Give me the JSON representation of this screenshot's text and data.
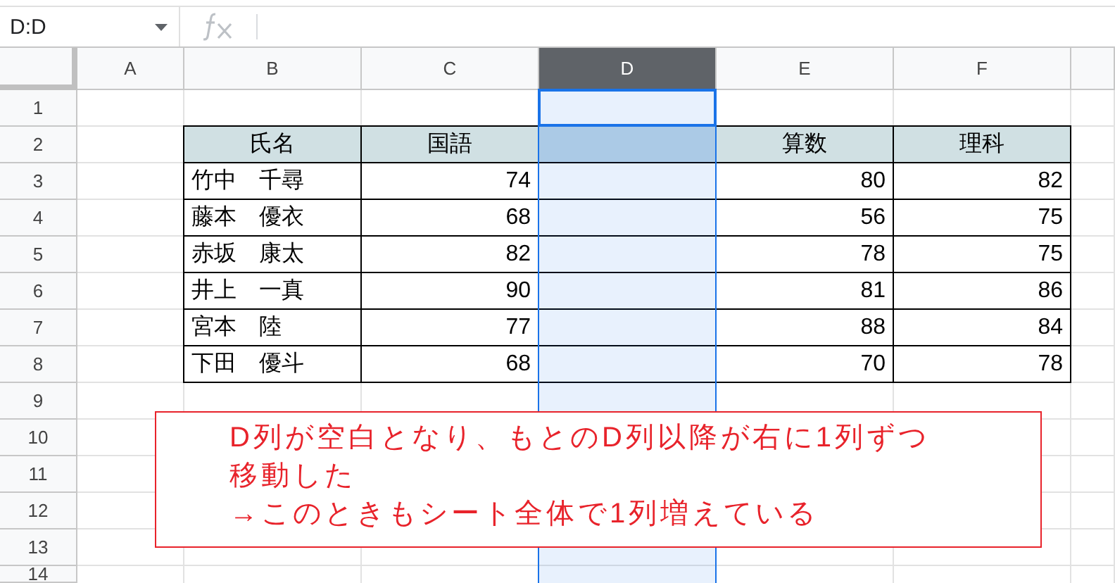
{
  "name_box": {
    "value": "D:D"
  },
  "columns": [
    {
      "label": "A",
      "selected": false
    },
    {
      "label": "B",
      "selected": false
    },
    {
      "label": "C",
      "selected": false
    },
    {
      "label": "D",
      "selected": true
    },
    {
      "label": "E",
      "selected": false
    },
    {
      "label": "F",
      "selected": false
    }
  ],
  "rows": [
    "1",
    "2",
    "3",
    "4",
    "5",
    "6",
    "7",
    "8",
    "9",
    "10",
    "11",
    "12",
    "13",
    "14"
  ],
  "table": {
    "columns": [
      {
        "heading": "氏名",
        "kind": "text"
      },
      {
        "heading": "国語",
        "kind": "number"
      },
      {
        "kind": "blank"
      },
      {
        "heading": "算数",
        "kind": "number"
      },
      {
        "heading": "理科",
        "kind": "number"
      }
    ],
    "rows": [
      {
        "cells": [
          "竹中　千尋",
          "74",
          "80",
          "82"
        ]
      },
      {
        "cells": [
          "藤本　優衣",
          "68",
          "56",
          "75"
        ]
      },
      {
        "cells": [
          "赤坂　康太",
          "82",
          "78",
          "75"
        ]
      },
      {
        "cells": [
          "井上　一真",
          "90",
          "81",
          "86"
        ]
      },
      {
        "cells": [
          "宮本　陸",
          "77",
          "88",
          "84"
        ]
      },
      {
        "cells": [
          "下田　優斗",
          "68",
          "70",
          "78"
        ]
      }
    ]
  },
  "callout": {
    "lines": [
      "D列が空白となり、もとのD列以降が右に1列ずつ",
      "移動した",
      "→このときもシート全体で1列増えている"
    ]
  }
}
